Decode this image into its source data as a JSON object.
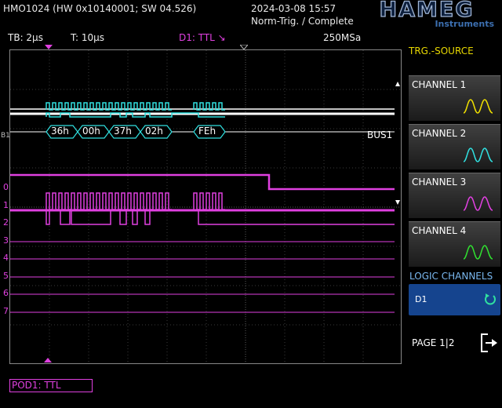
{
  "header": {
    "model": "HMO1024 (HW 0x10140001; SW 04.526)",
    "datetime": "2024-03-08 15:57",
    "status": "Norm-Trig. / Complete",
    "logo_main": "HAMEG",
    "logo_sub": "Instruments"
  },
  "toolbar": {
    "timebase": "TB: 2µs",
    "trigger_time": "T: 10µs",
    "trigger_source": "D1: TTL ↘",
    "sample_rate": "250MSa"
  },
  "screen": {
    "bus_label": "BUS1",
    "bus_marker": "B1",
    "bus_values": [
      "36h",
      "00h",
      "37h",
      "02h",
      "FEh"
    ],
    "channel_tags": [
      "0",
      "1",
      "2",
      "3",
      "4",
      "5",
      "6",
      "7"
    ]
  },
  "side_menu": {
    "title": "TRG.-SOURCE",
    "channels": [
      {
        "label": "CHANNEL 1",
        "color": "#f0e000"
      },
      {
        "label": "CHANNEL 2",
        "color": "#30e0e0"
      },
      {
        "label": "CHANNEL 3",
        "color": "#e040e0"
      },
      {
        "label": "CHANNEL 4",
        "color": "#30e030"
      }
    ],
    "logic_title": "LOGIC CHANNELS",
    "logic_selected": "D1",
    "page": "PAGE 1|2"
  },
  "footer": {
    "pod": "POD1: TTL"
  }
}
